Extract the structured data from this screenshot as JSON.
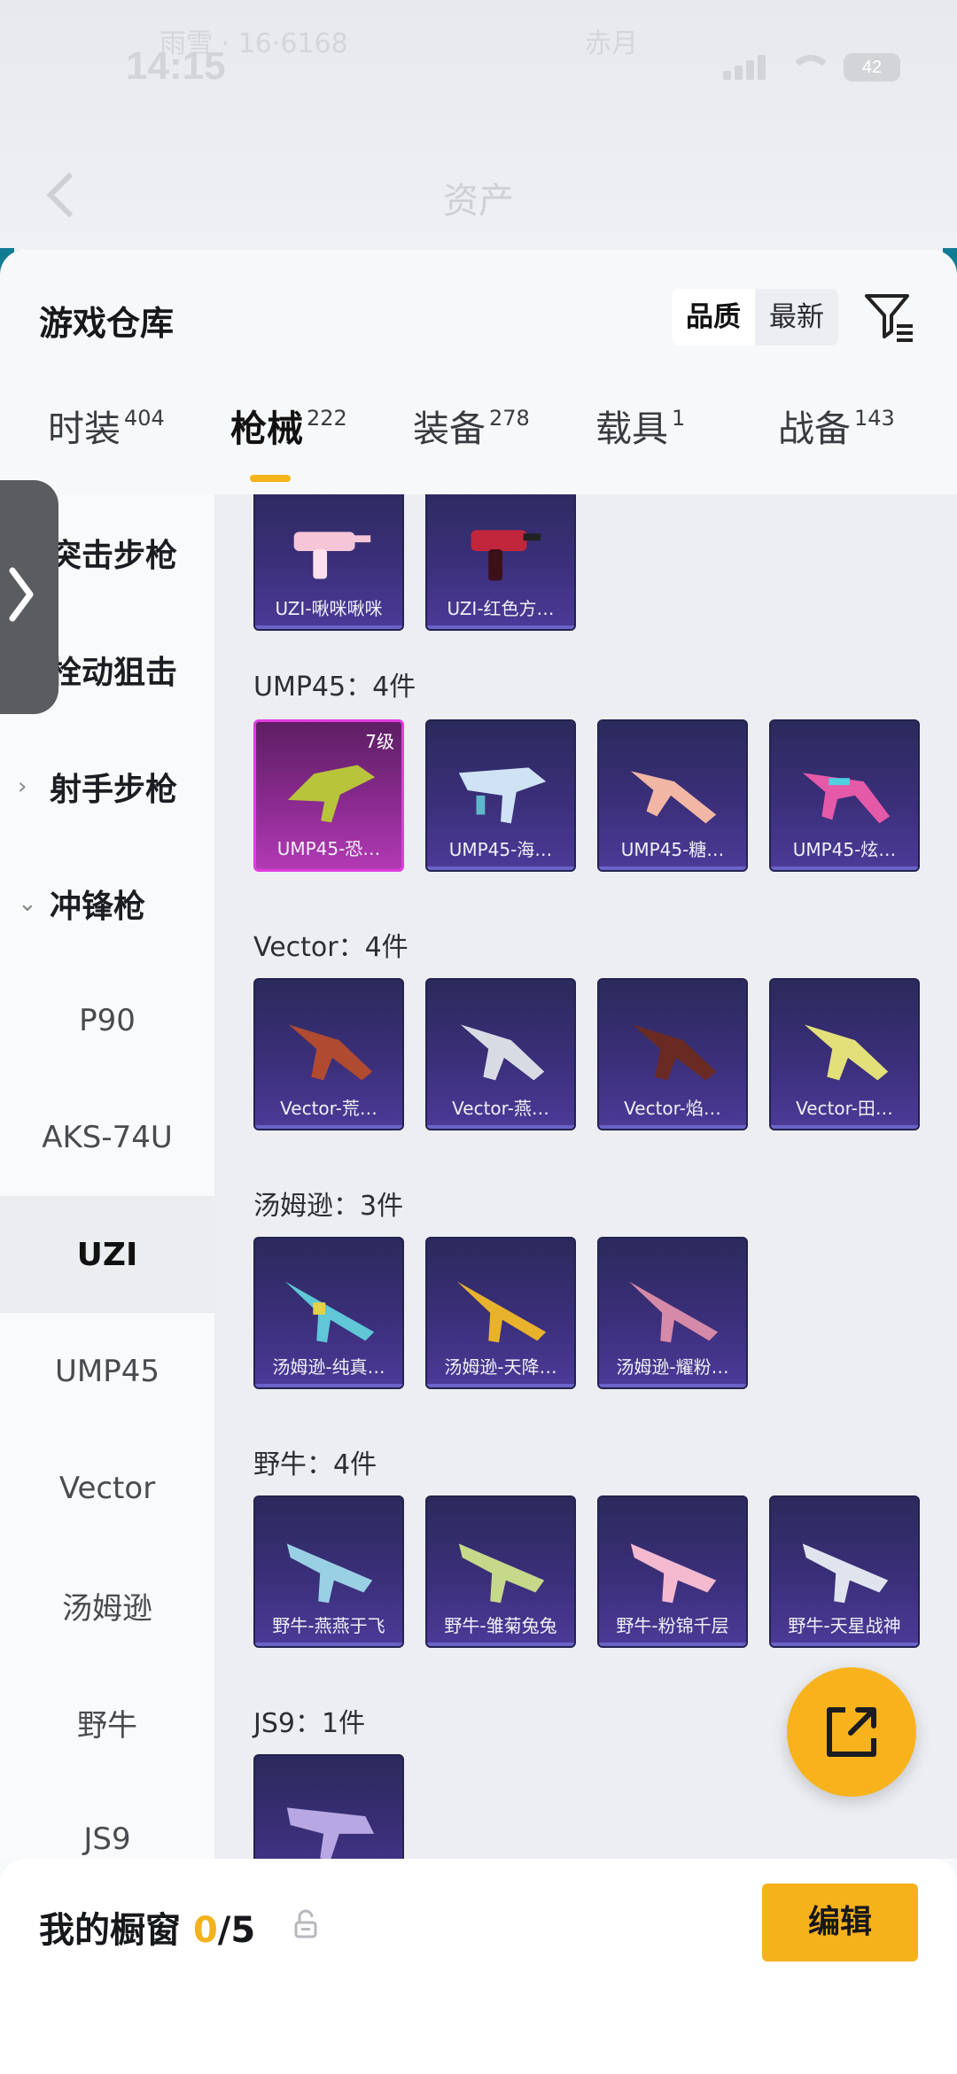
{
  "status_bar": {
    "time": "14:15",
    "battery": "42",
    "overlay_left": "雨雪 · 16·6168",
    "overlay_right": "赤月"
  },
  "header": {
    "title": "资产"
  },
  "sheet": {
    "title": "游戏仓库",
    "sort_options": [
      "品质",
      "最新"
    ],
    "selected_sort": "品质"
  },
  "tabs": [
    {
      "label": "时装",
      "count": "404"
    },
    {
      "label": "枪械",
      "count": "222"
    },
    {
      "label": "装备",
      "count": "278"
    },
    {
      "label": "载具",
      "count": "1"
    },
    {
      "label": "战备",
      "count": "143"
    }
  ],
  "active_tab": "枪械",
  "sidebar": {
    "categories": [
      {
        "label": "突击步枪",
        "expanded": false
      },
      {
        "label": "栓动狙击",
        "expanded": false
      },
      {
        "label": "射手步枪",
        "expanded": false
      },
      {
        "label": "冲锋枪",
        "expanded": true
      }
    ],
    "items": [
      "P90",
      "AKS-74U",
      "UZI",
      "UMP45",
      "Vector",
      "汤姆逊",
      "野牛",
      "JS9"
    ],
    "active_item": "UZI"
  },
  "groups": [
    {
      "title": "",
      "cards": [
        {
          "name": "UZI-啾咪啾咪",
          "level": ""
        },
        {
          "name": "UZI-红色方…",
          "level": ""
        }
      ]
    },
    {
      "title": "UMP45：4件",
      "cards": [
        {
          "name": "UMP45-恐…",
          "level": "7级"
        },
        {
          "name": "UMP45-海…",
          "level": ""
        },
        {
          "name": "UMP45-糖…",
          "level": ""
        },
        {
          "name": "UMP45-炫…",
          "level": ""
        }
      ]
    },
    {
      "title": "Vector：4件",
      "cards": [
        {
          "name": "Vector-荒…",
          "level": ""
        },
        {
          "name": "Vector-燕…",
          "level": ""
        },
        {
          "name": "Vector-焰…",
          "level": ""
        },
        {
          "name": "Vector-田…",
          "level": ""
        }
      ]
    },
    {
      "title": "汤姆逊：3件",
      "cards": [
        {
          "name": "汤姆逊-纯真…",
          "level": ""
        },
        {
          "name": "汤姆逊-天降…",
          "level": ""
        },
        {
          "name": "汤姆逊-耀粉…",
          "level": ""
        }
      ]
    },
    {
      "title": "野牛：4件",
      "cards": [
        {
          "name": "野牛-燕燕于飞",
          "level": ""
        },
        {
          "name": "野牛-雏菊兔兔",
          "level": ""
        },
        {
          "name": "野牛-粉锦千层",
          "level": ""
        },
        {
          "name": "野牛-天星战神",
          "level": ""
        }
      ]
    },
    {
      "title": "JS9：1件",
      "cards": [
        {
          "name": "",
          "level": ""
        }
      ]
    }
  ],
  "bottom_bar": {
    "label": "我的橱窗",
    "current": "0",
    "total": "/5",
    "edit_label": "编辑"
  },
  "colors": {
    "accent": "#f6b21b",
    "card_bg": "#3b2f7a",
    "card_highlight": "#e13ce0"
  }
}
